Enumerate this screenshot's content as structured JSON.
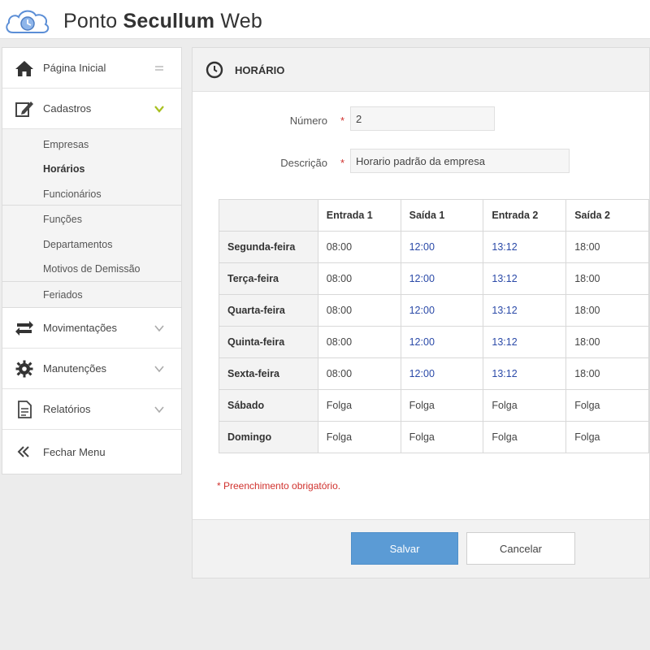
{
  "app": {
    "brand_regular": "Ponto ",
    "brand_bold": "Secullum",
    "brand_suffix": " Web"
  },
  "sidebar": {
    "items": [
      {
        "label": "Página Inicial",
        "icon": "home-icon"
      },
      {
        "label": "Cadastros",
        "icon": "edit-icon"
      },
      {
        "label": "Movimentações",
        "icon": "swap-icon"
      },
      {
        "label": "Manutenções",
        "icon": "gear-icon"
      },
      {
        "label": "Relatórios",
        "icon": "report-icon"
      },
      {
        "label": "Fechar Menu",
        "icon": "double-chevron-left-icon"
      }
    ],
    "cadastros_sub": [
      "Empresas",
      "Horários",
      "Funcionários",
      "Funções",
      "Departamentos",
      "Motivos de Demissão",
      "Feriados"
    ],
    "active_sub": "Horários",
    "colors": {
      "cadastros_chevron": "#a8c020"
    }
  },
  "panel": {
    "title": "HORÁRIO",
    "fields": {
      "numero": {
        "label": "Número",
        "value": "2",
        "required_mark": "*"
      },
      "descricao": {
        "label": "Descrição",
        "value": "Horario padrão da empresa",
        "required_mark": "*"
      }
    },
    "table": {
      "headers": [
        "",
        "Entrada 1",
        "Saída 1",
        "Entrada 2",
        "Saída 2"
      ],
      "rows": [
        [
          "Segunda-feira",
          "08:00",
          "12:00",
          "13:12",
          "18:00"
        ],
        [
          "Terça-feira",
          "08:00",
          "12:00",
          "13:12",
          "18:00"
        ],
        [
          "Quarta-feira",
          "08:00",
          "12:00",
          "13:12",
          "18:00"
        ],
        [
          "Quinta-feira",
          "08:00",
          "12:00",
          "13:12",
          "18:00"
        ],
        [
          "Sexta-feira",
          "08:00",
          "12:00",
          "13:12",
          "18:00"
        ],
        [
          "Sábado",
          "Folga",
          "Folga",
          "Folga",
          "Folga"
        ],
        [
          "Domingo",
          "Folga",
          "Folga",
          "Folga",
          "Folga"
        ]
      ]
    },
    "required_note": "* Preenchimento obrigatório.",
    "buttons": {
      "save": "Salvar",
      "cancel": "Cancelar"
    },
    "colors": {
      "save_bg": "#5b9bd5",
      "required": "#d0312d",
      "time_blue": "#2b4aa8"
    }
  }
}
